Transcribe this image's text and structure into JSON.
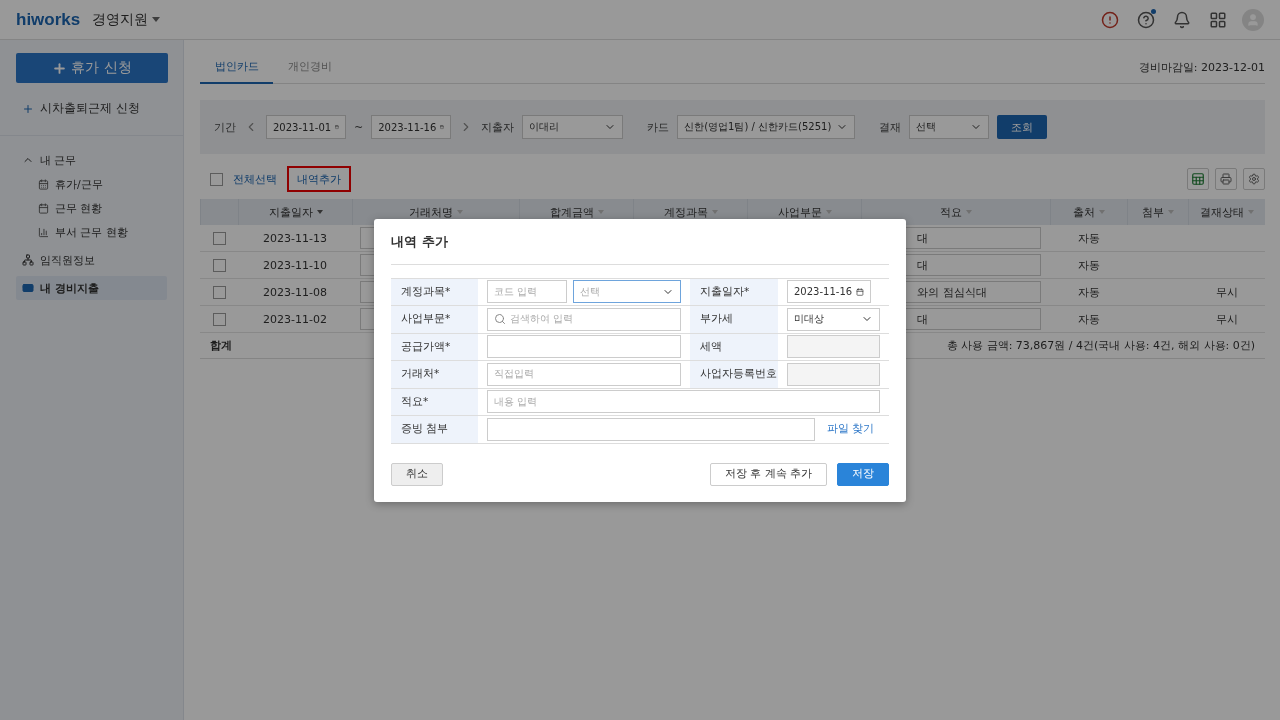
{
  "header": {
    "logo": "hiworks",
    "workspace": "경영지원"
  },
  "sidebar": {
    "primary_button": "휴가 신청",
    "secondary_link": "시차출퇴근제 신청",
    "nav": [
      {
        "label": "내 근무",
        "expanded": true,
        "selected": false,
        "children": [
          {
            "label": "휴가/근무",
            "selected": false
          },
          {
            "label": "근무 현황",
            "selected": false
          },
          {
            "label": "부서 근무 현황",
            "selected": false
          }
        ]
      },
      {
        "label": "임직원정보",
        "selected": false
      },
      {
        "label": "내 경비지출",
        "selected": true
      }
    ]
  },
  "tabs": [
    {
      "label": "법인카드",
      "selected": true
    },
    {
      "label": "개인경비",
      "selected": false
    }
  ],
  "deadline": "경비마감일: 2023-12-01",
  "filters": {
    "period_label": "기간",
    "date_from": "2023-11-01",
    "range_separator": "~",
    "date_to": "2023-11-16",
    "spender_label": "지출자",
    "spender": "이대리",
    "card_label": "카드",
    "card": "신한(영업1팀) / 신한카드(5251)",
    "approval_label": "결재",
    "approval": "선택",
    "search_button": "조회"
  },
  "actions": {
    "select_all": {
      "label": "전체선택",
      "checked": false
    },
    "add_button": {
      "label": "내역추가",
      "highlighted": true
    }
  },
  "table": {
    "columns": [
      {
        "label": "지출일자",
        "sorted": true
      },
      {
        "label": "거래처명",
        "sorted": false
      },
      {
        "label": "합계금액",
        "sorted": false
      },
      {
        "label": "계정과목",
        "sorted": false
      },
      {
        "label": "사업부문",
        "sorted": false
      },
      {
        "label": "적요",
        "sorted": false
      },
      {
        "label": "출처",
        "sorted": false
      },
      {
        "label": "첨부",
        "sorted": false
      },
      {
        "label": "결재상태",
        "sorted": false
      }
    ],
    "rows": [
      {
        "checked": false,
        "date": "2023-11-13",
        "summary": "대",
        "source": "자동"
      },
      {
        "checked": false,
        "date": "2023-11-10",
        "summary": "대",
        "source": "자동"
      },
      {
        "checked": false,
        "date": "2023-11-08",
        "summary": "와의 점심식대",
        "source": "자동",
        "status": "무시"
      },
      {
        "checked": false,
        "date": "2023-11-02",
        "summary": "대",
        "source": "자동",
        "status": "무시"
      }
    ],
    "total_label": "합계",
    "total_text": "총 사용 금액: 73,867원 / 4건(국내 사용: 4건, 해외 사용: 0건)"
  },
  "modal": {
    "title": "내역 추가",
    "rows": [
      {
        "fields": [
          {
            "label": "계정과목*",
            "kind": "code_select",
            "placeholder": "코드 입력",
            "select_placeholder": "선택",
            "focused": true
          },
          {
            "label": "지출일자*",
            "kind": "date",
            "value": "2023-11-16"
          }
        ]
      },
      {
        "fields": [
          {
            "label": "사업부문*",
            "kind": "search",
            "placeholder": "검색하여 입력"
          },
          {
            "label": "부가세",
            "kind": "select",
            "value": "미대상"
          }
        ]
      },
      {
        "fields": [
          {
            "label": "공급가액*",
            "kind": "text"
          },
          {
            "label": "세액",
            "kind": "readonly"
          }
        ]
      },
      {
        "fields": [
          {
            "label": "거래처*",
            "kind": "text",
            "placeholder": "직접입력"
          },
          {
            "label": "사업자등록번호",
            "kind": "readonly"
          }
        ]
      },
      {
        "fields": [
          {
            "label": "적요*",
            "kind": "text",
            "placeholder": "내용 입력"
          }
        ]
      },
      {
        "fields": [
          {
            "label": "증빙 첨부",
            "kind": "file",
            "link": "파일 찾기"
          }
        ]
      }
    ],
    "cancel_button": "취소",
    "save_continue_button": "저장 후 계속 추가",
    "save_button": "저장"
  }
}
